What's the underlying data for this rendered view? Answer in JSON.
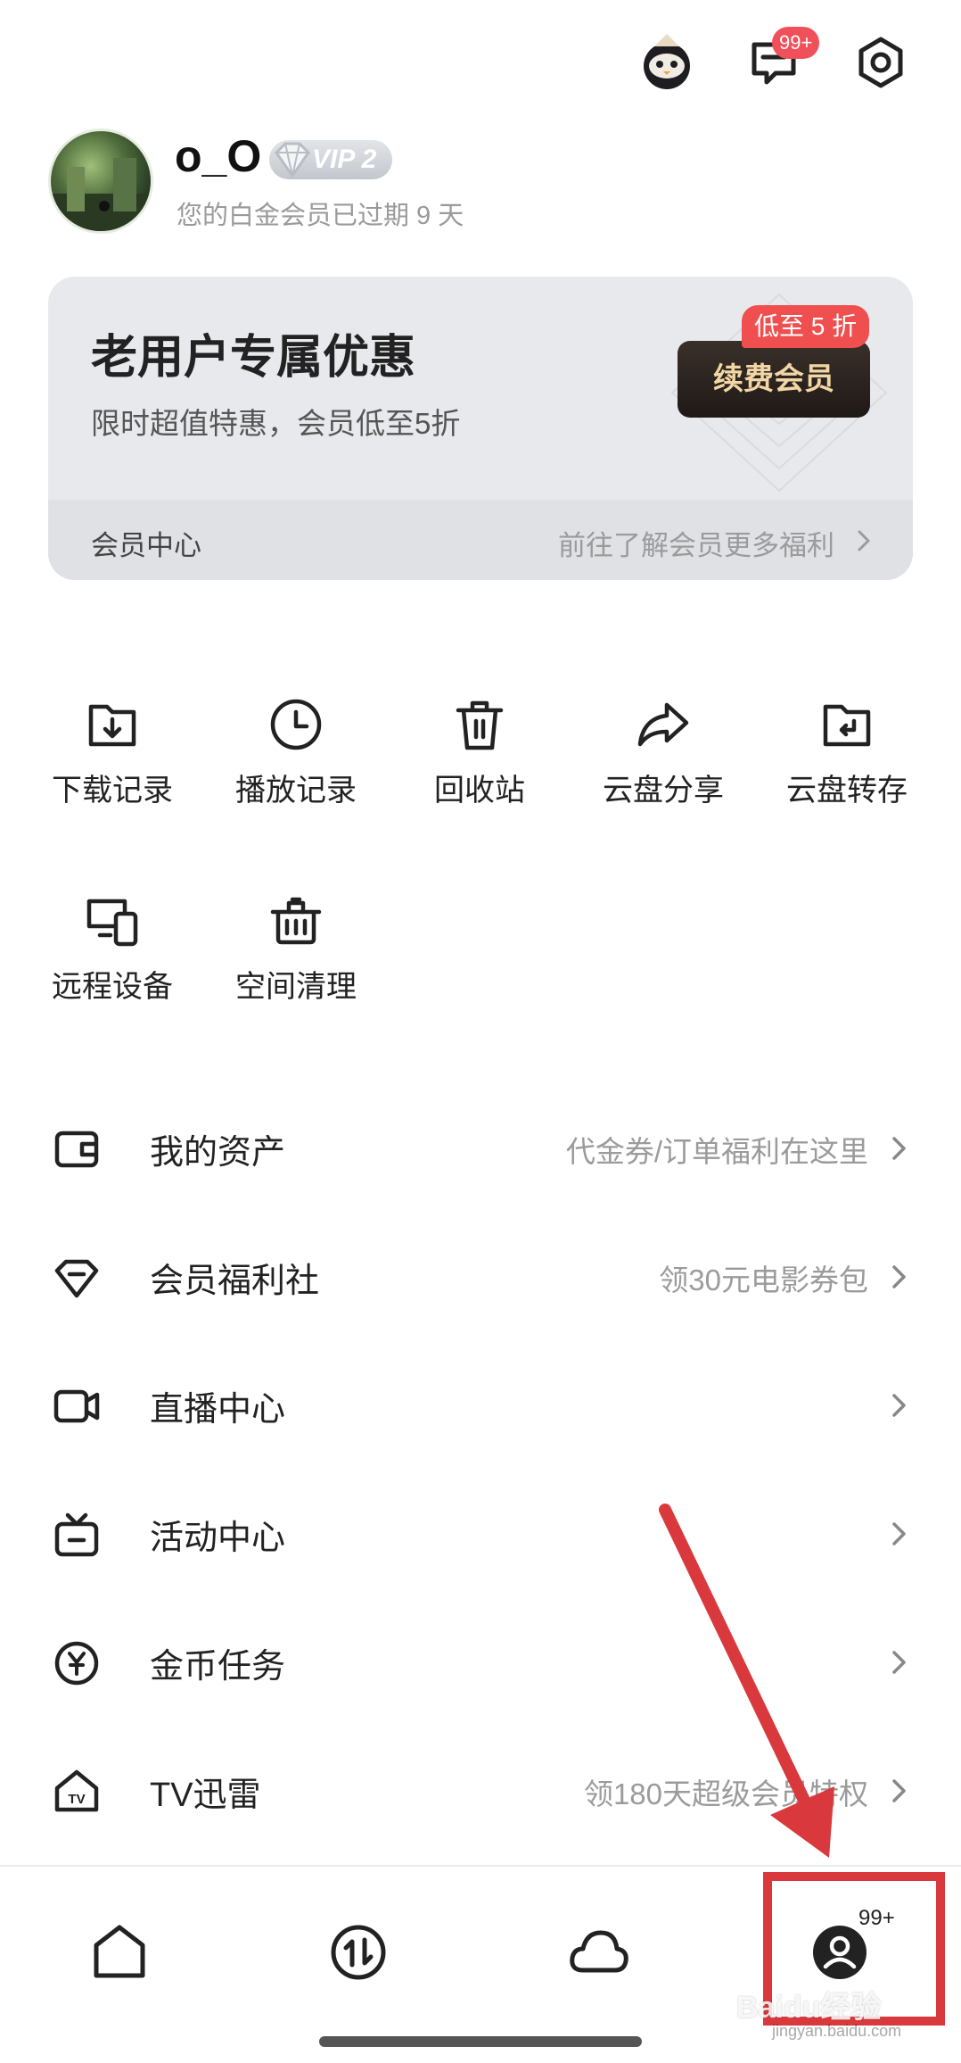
{
  "header": {
    "message_badge": "99+"
  },
  "profile": {
    "username": "o_O",
    "vip_level": "VIP 2",
    "membership_status": "您的白金会员已过期 9 天"
  },
  "promo": {
    "title": "老用户专属优惠",
    "subtitle": "限时超值特惠，会员低至5折",
    "renew_button": "续费会员",
    "discount_tag": "低至 5 折",
    "footer_left": "会员中心",
    "footer_right": "前往了解会员更多福利"
  },
  "shortcuts": [
    {
      "label": "下载记录",
      "icon": "download-folder-icon"
    },
    {
      "label": "播放记录",
      "icon": "clock-icon"
    },
    {
      "label": "回收站",
      "icon": "trash-icon"
    },
    {
      "label": "云盘分享",
      "icon": "share-arrow-icon"
    },
    {
      "label": "云盘转存",
      "icon": "folder-return-icon"
    },
    {
      "label": "远程设备",
      "icon": "devices-icon"
    },
    {
      "label": "空间清理",
      "icon": "cleanup-bucket-icon"
    }
  ],
  "menu": [
    {
      "title": "我的资产",
      "hint": "代金券/订单福利在这里",
      "icon": "wallet-icon"
    },
    {
      "title": "会员福利社",
      "hint": "领30元电影券包",
      "icon": "diamond-icon"
    },
    {
      "title": "直播中心",
      "hint": "",
      "icon": "video-camera-icon"
    },
    {
      "title": "活动中心",
      "hint": "",
      "icon": "tv-box-icon"
    },
    {
      "title": "金币任务",
      "hint": "",
      "icon": "yen-coin-icon"
    },
    {
      "title": "TV迅雷",
      "hint": "领180天超级会员特权",
      "icon": "tv-house-icon"
    }
  ],
  "bottom_nav": {
    "items": [
      "home-icon",
      "transfer-icon",
      "cloud-icon",
      "profile-icon"
    ],
    "profile_badge": "99+"
  },
  "watermark": {
    "text": "Baidu经验",
    "url": "jingyan.baidu.com"
  },
  "colors": {
    "accent_red": "#f04f4f",
    "annotation_red": "#d9393d",
    "renew_gold": "#f2d6a6"
  }
}
